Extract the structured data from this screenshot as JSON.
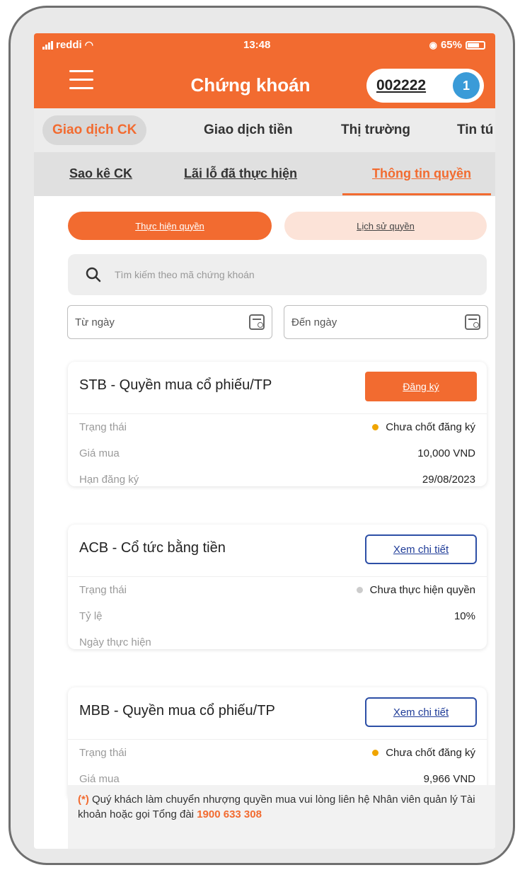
{
  "status_bar": {
    "carrier": "reddi",
    "time": "13:48",
    "battery": "65%"
  },
  "header": {
    "title": "Chứng khoán",
    "account": "002222",
    "notification_count": "1"
  },
  "tabs_primary": [
    {
      "label": "Giao dịch CK",
      "active": true
    },
    {
      "label": "Giao dịch tiền",
      "active": false
    },
    {
      "label": "Thị trường",
      "active": false
    },
    {
      "label": "Tin tú",
      "active": false
    }
  ],
  "tabs_secondary": [
    {
      "label": "Sao kê CK",
      "active": false
    },
    {
      "label": "Lãi lỗ đã thực hiện",
      "active": false
    },
    {
      "label": "Thông tin quyền",
      "active": true
    }
  ],
  "segments": [
    {
      "label": "Thực hiện quyền",
      "active": true
    },
    {
      "label": "Lịch sử quyền",
      "active": false
    }
  ],
  "search": {
    "placeholder": "Tìm kiếm theo mã chứng khoán"
  },
  "filters": {
    "from_date": "Từ ngày",
    "to_date": "Đến ngày"
  },
  "cards": [
    {
      "title": "STB - Quyền mua cổ phiếu/TP",
      "action": "Đăng ký",
      "rows": [
        {
          "label": "Trạng thái",
          "value": "Chưa chốt đăng ký",
          "dot_color": "#f0a500"
        },
        {
          "label": "Giá mua",
          "value": "10,000 VND"
        },
        {
          "label": "Hạn đăng ký",
          "value": "29/08/2023"
        }
      ]
    },
    {
      "title": "ACB - Cổ tức bằng tiền",
      "action": "Xem chi tiết",
      "rows": [
        {
          "label": "Trạng thái",
          "value": "Chưa thực hiện quyền",
          "dot_color": "#cccccc"
        },
        {
          "label": "Tỷ lệ",
          "value": "10%"
        },
        {
          "label": "Ngày thực hiện",
          "value": ""
        }
      ]
    },
    {
      "title": "MBB - Quyền mua cổ phiếu/TP",
      "action": "Xem chi tiết",
      "rows": [
        {
          "label": "Trạng thái",
          "value": "Chưa chốt đăng ký",
          "dot_color": "#f0a500"
        },
        {
          "label": "Giá mua",
          "value": "9,966 VND"
        }
      ]
    }
  ],
  "footer": {
    "marker": "(*)",
    "text": " Quý khách làm chuyển nhượng quyền mua vui lòng liên hệ Nhân viên quản lý Tài khoản hoặc gọi Tổng đài ",
    "hotline": "1900 633 308"
  },
  "colors": {
    "brand": "#f26b30",
    "badge": "#3a9bd8",
    "link": "#1f3c98"
  }
}
